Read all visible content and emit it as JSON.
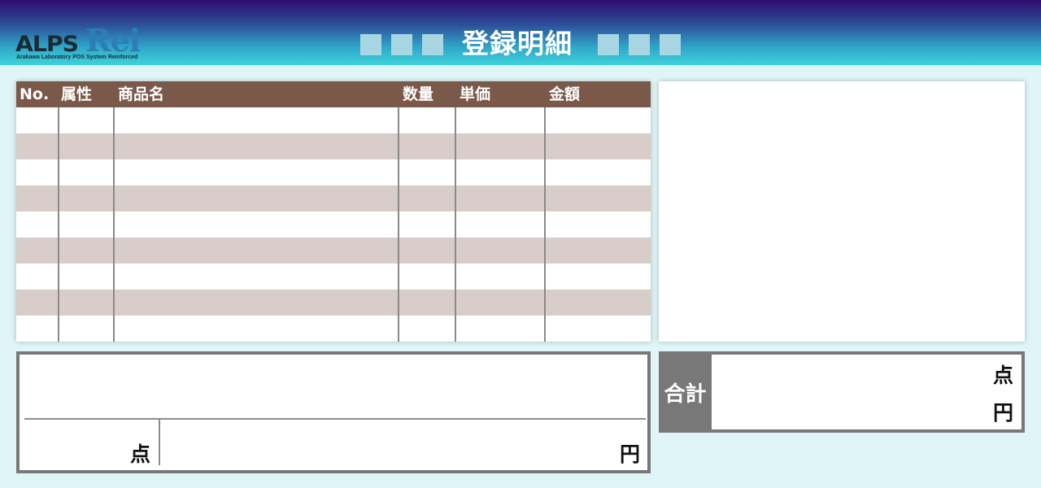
{
  "header": {
    "logo": {
      "main": "ALPS",
      "accent": "Rei",
      "subtitle": "Arakawa Laboratory POS System Reinforced"
    },
    "title": "登録明細",
    "colors": {
      "gradient_top": "#2e0c6e",
      "gradient_bottom": "#3ed2da",
      "title": "#ffffff"
    }
  },
  "table": {
    "header_color": "#7a584a",
    "alt_row_color": "#d8cdc9",
    "columns": [
      "No.",
      "属性",
      "商品名",
      "数量",
      "単価",
      "金額"
    ],
    "rows": [
      [
        "",
        "",
        "",
        "",
        "",
        ""
      ],
      [
        "",
        "",
        "",
        "",
        "",
        ""
      ],
      [
        "",
        "",
        "",
        "",
        "",
        ""
      ],
      [
        "",
        "",
        "",
        "",
        "",
        ""
      ],
      [
        "",
        "",
        "",
        "",
        "",
        ""
      ],
      [
        "",
        "",
        "",
        "",
        "",
        ""
      ],
      [
        "",
        "",
        "",
        "",
        "",
        ""
      ],
      [
        "",
        "",
        "",
        "",
        "",
        ""
      ],
      [
        "",
        "",
        "",
        "",
        "",
        ""
      ]
    ]
  },
  "subtotal": {
    "message": "",
    "count": "",
    "count_unit": "点",
    "amount": "",
    "amount_unit": "円"
  },
  "total": {
    "label": "合計",
    "count": "",
    "count_unit": "点",
    "amount": "",
    "amount_unit": "円"
  }
}
